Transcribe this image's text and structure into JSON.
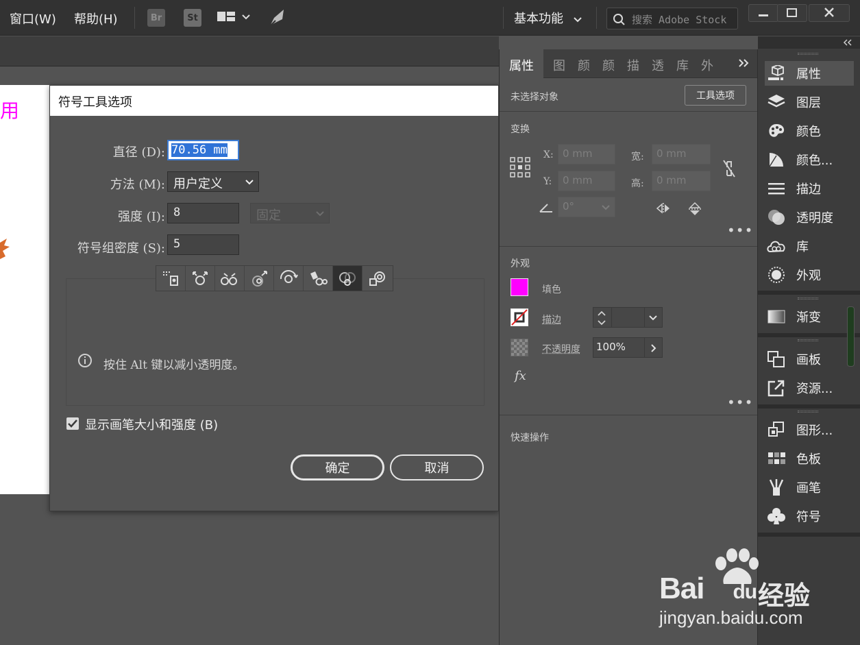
{
  "menubar": {
    "menus": [
      "窗口(W)",
      "帮助(H)"
    ],
    "apps": [
      "Br",
      "St"
    ],
    "workspace": "基本功能",
    "search_placeholder": "搜索 Adobe Stock",
    "colors": {
      "bg": "#323232",
      "br_badge": "#5a5a5a",
      "st_badge": "#6a6a6a"
    }
  },
  "artboard": {
    "text_fragment": "用"
  },
  "dialog": {
    "title": "符号工具选项",
    "diameter_label": "直径 (D):",
    "diameter_value": "70.56 mm",
    "method_label": "方法 (M):",
    "method_value": "用户定义",
    "intensity_label": "强度 (I):",
    "intensity_value": "8",
    "intensity_mode": "固定",
    "density_label": "符号组密度 (S):",
    "density_value": "5",
    "tools": [
      "symbol-sprayer",
      "symbol-shifter",
      "symbol-scruncher",
      "symbol-sizer",
      "symbol-spinner",
      "symbol-stainer",
      "symbol-screener",
      "symbol-styler"
    ],
    "active_tool_index": 6,
    "hint": "按住 Alt 键以减小透明度。",
    "show_brush_label": "显示画笔大小和强度 (B)",
    "show_brush_checked": true,
    "ok": "确定",
    "cancel": "取消"
  },
  "properties": {
    "tabs": [
      "属性",
      "图",
      "颜",
      "颜",
      "描",
      "透",
      "库",
      "外"
    ],
    "no_selection": "未选择对象",
    "tool_options": "工具选项",
    "transform_title": "变换",
    "x_label": "X:",
    "y_label": "Y:",
    "w_label": "宽:",
    "h_label": "高:",
    "x_value": "0 mm",
    "y_value": "0 mm",
    "w_value": "0 mm",
    "h_value": "0 mm",
    "angle_value": "0°",
    "appearance_title": "外观",
    "fill_label": "填色",
    "fill_color": "#ff00ff",
    "stroke_label": "描边",
    "opacity_label": "不透明度",
    "opacity_value": "100%",
    "fx_label": "fx",
    "quick_actions": "快速操作"
  },
  "dock": {
    "items": [
      {
        "label": "属性",
        "icon": "properties-icon"
      },
      {
        "label": "图层",
        "icon": "layers-icon"
      },
      {
        "label": "颜色",
        "icon": "color-icon"
      },
      {
        "label": "颜色...",
        "icon": "color-guide-icon"
      },
      {
        "label": "描边",
        "icon": "stroke-icon"
      },
      {
        "label": "透明度",
        "icon": "transparency-icon"
      },
      {
        "label": "库",
        "icon": "libraries-icon"
      },
      {
        "label": "外观",
        "icon": "appearance-icon"
      },
      {
        "label": "渐变",
        "icon": "gradient-icon"
      },
      {
        "label": "画板",
        "icon": "artboards-icon"
      },
      {
        "label": "资源...",
        "icon": "asset-export-icon"
      },
      {
        "label": "图形...",
        "icon": "graphic-styles-icon"
      },
      {
        "label": "色板",
        "icon": "swatches-icon"
      },
      {
        "label": "画笔",
        "icon": "brushes-icon"
      },
      {
        "label": "符号",
        "icon": "symbols-icon"
      }
    ]
  },
  "watermark": {
    "brand_left": "Bai",
    "brand_right": "du",
    "brand_cn": "经验",
    "url": "jingyan.baidu.com"
  }
}
